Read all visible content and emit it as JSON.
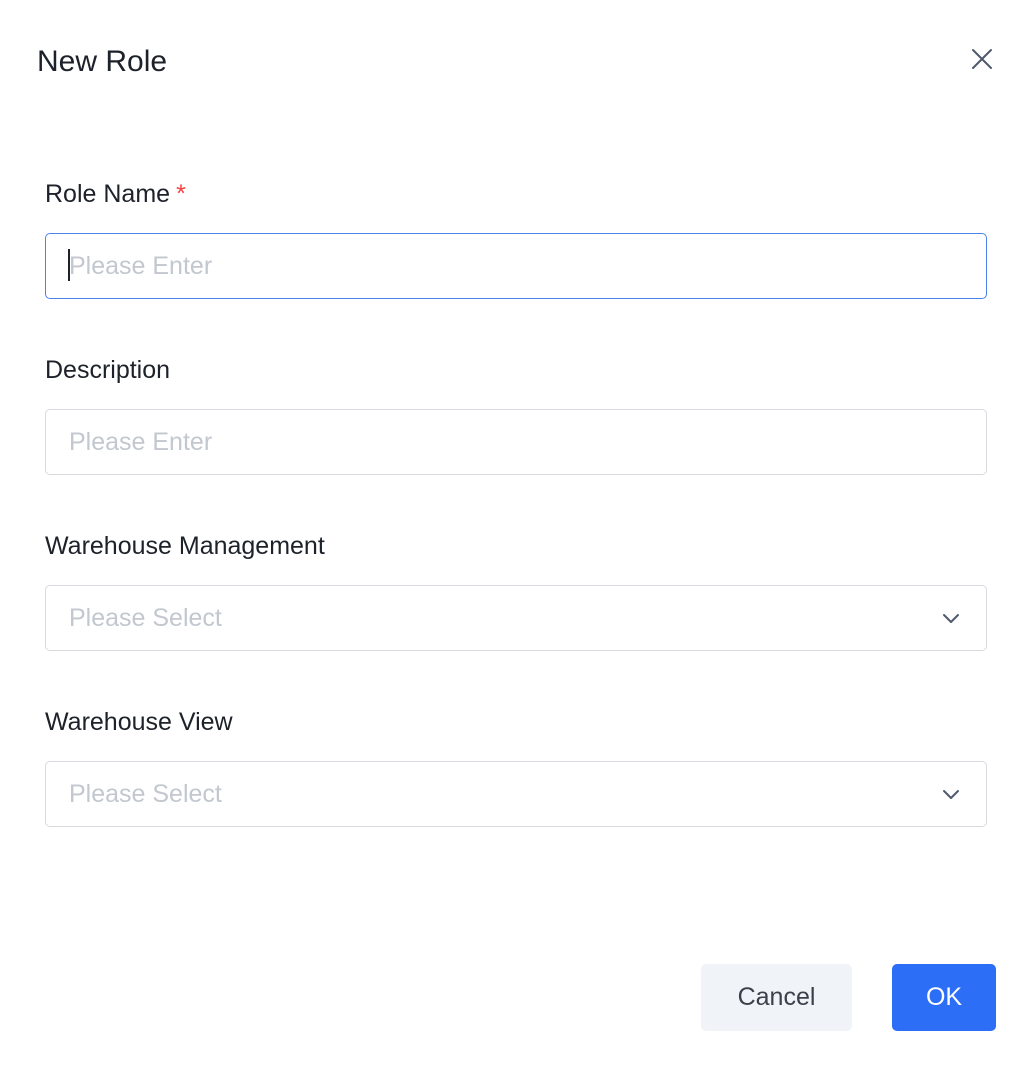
{
  "dialog": {
    "title": "New Role",
    "close_icon": "close-icon"
  },
  "form": {
    "role_name": {
      "label": "Role Name",
      "required_mark": "*",
      "placeholder": "Please Enter",
      "value": ""
    },
    "description": {
      "label": "Description",
      "placeholder": "Please Enter",
      "value": ""
    },
    "warehouse_management": {
      "label": "Warehouse Management",
      "placeholder": "Please Select",
      "icon": "chevron-down-icon"
    },
    "warehouse_view": {
      "label": "Warehouse View",
      "placeholder": "Please Select",
      "icon": "chevron-down-icon"
    }
  },
  "footer": {
    "cancel_label": "Cancel",
    "ok_label": "OK"
  },
  "colors": {
    "primary": "#2d6ef6",
    "focus_border": "#4a83ee",
    "required": "#f53f3f",
    "placeholder": "#c2c7d0",
    "cancel_bg": "#f0f3f8"
  }
}
